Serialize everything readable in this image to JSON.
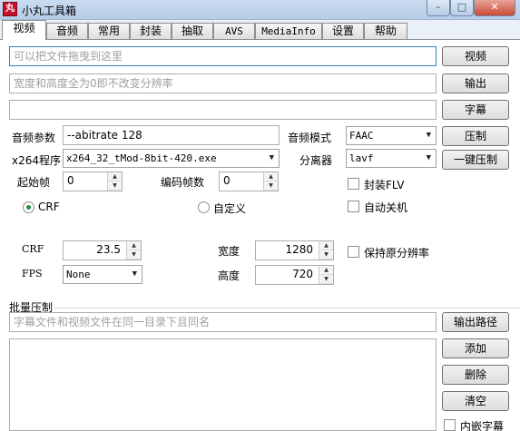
{
  "window": {
    "title": "小丸工具箱",
    "min_glyph": "–",
    "max_glyph": "□",
    "close_glyph": "✕"
  },
  "tabs": [
    "视频",
    "音频",
    "常用",
    "封装",
    "抽取",
    "AVS",
    "MediaInfo",
    "设置",
    "帮助"
  ],
  "video": {
    "drop_placeholder": "可以把文件拖曳到这里",
    "resolution_placeholder": "宽度和高度全为0即不改变分辨率",
    "subtitle_value": "",
    "btn_video": "视频",
    "btn_output": "输出",
    "btn_subtitle": "字幕",
    "btn_compress": "压制",
    "btn_one_click": "一键压制",
    "audio_params_label": "音频参数",
    "audio_params_value": "--abitrate 128",
    "audio_mode_label": "音频模式",
    "audio_mode_value": "FAAC",
    "x264_label": "x264程序",
    "x264_value": "x264_32_tMod-8bit-420.exe",
    "splitter_label": "分离器",
    "splitter_value": "lavf",
    "start_frame_label": "起始帧",
    "start_frame_value": "0",
    "encode_frames_label": "编码帧数",
    "encode_frames_value": "0",
    "pack_flv_label": "封装FLV",
    "auto_shutdown_label": "自动关机",
    "crf_radio_label": "CRF",
    "custom_radio_label": "自定义",
    "crf_label": "CRF",
    "crf_value": "23.5",
    "fps_label": "FPS",
    "fps_value": "None",
    "width_label": "宽度",
    "width_value": "1280",
    "height_label": "高度",
    "height_value": "720",
    "keep_res_label": "保持原分辨率",
    "batch_title": "批量压制",
    "batch_placeholder": "字幕文件和视频文件在同一目录下且同名",
    "btn_output_path": "输出路径",
    "btn_add": "添加",
    "btn_delete": "删除",
    "btn_clear": "清空",
    "embed_subtitle_label": "内嵌字幕"
  }
}
